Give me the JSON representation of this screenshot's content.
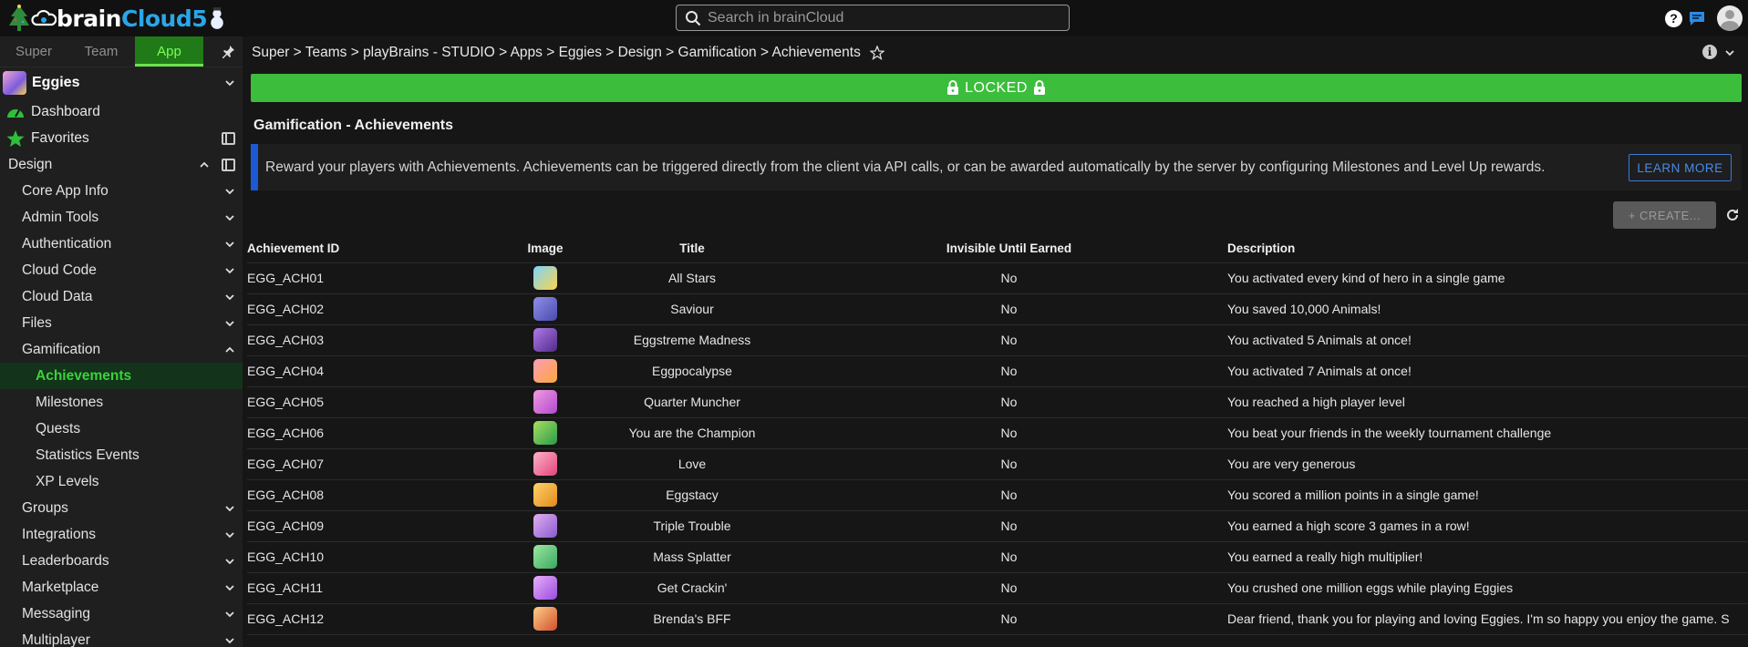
{
  "header": {
    "logo_part1": "brain",
    "logo_part2": "Cloud5",
    "search_placeholder": "Search in brainCloud",
    "help_label": "?"
  },
  "sidebar": {
    "tabs": [
      {
        "label": "Super",
        "active": false
      },
      {
        "label": "Team",
        "active": false
      },
      {
        "label": "App",
        "active": true
      }
    ],
    "app_name": "Eggies",
    "dashboard": "Dashboard",
    "favorites": "Favorites",
    "design": "Design",
    "items": [
      {
        "label": "Core App Info"
      },
      {
        "label": "Admin Tools"
      },
      {
        "label": "Authentication"
      },
      {
        "label": "Cloud Code"
      },
      {
        "label": "Cloud Data"
      },
      {
        "label": "Files"
      },
      {
        "label": "Gamification"
      }
    ],
    "gamification_sub": [
      {
        "label": "Achievements",
        "active": true
      },
      {
        "label": "Milestones"
      },
      {
        "label": "Quests"
      },
      {
        "label": "Statistics Events"
      },
      {
        "label": "XP Levels"
      }
    ],
    "items_after": [
      {
        "label": "Groups"
      },
      {
        "label": "Integrations"
      },
      {
        "label": "Leaderboards"
      },
      {
        "label": "Marketplace"
      },
      {
        "label": "Messaging"
      },
      {
        "label": "Multiplayer"
      }
    ]
  },
  "main": {
    "breadcrumb": "Super > Teams > playBrains - STUDIO > Apps > Eggies > Design > Gamification > Achievements",
    "info_label": "i",
    "locked_label": "LOCKED",
    "section_title": "Gamification - Achievements",
    "banner_text": "Reward your players with Achievements. Achievements can be triggered directly from the client via API calls, or can be awarded automatically by the server by configuring Milestones and Level Up rewards.",
    "learn_more": "LEARN MORE",
    "create_label": "+ CREATE...",
    "columns": {
      "id": "Achievement ID",
      "image": "Image",
      "title": "Title",
      "invisible": "Invisible Until Earned",
      "description": "Description"
    },
    "rows": [
      {
        "id": "EGG_ACH01",
        "title": "All Stars",
        "invisible": "No",
        "description": "You activated every kind of hero in a single game",
        "img": "linear-gradient(135deg,#7fd3ff,#f9d44a)"
      },
      {
        "id": "EGG_ACH02",
        "title": "Saviour",
        "invisible": "No",
        "description": "You saved 10,000 Animals!",
        "img": "linear-gradient(135deg,#8f8fe8,#4a4ab0)"
      },
      {
        "id": "EGG_ACH03",
        "title": "Eggstreme Madness",
        "invisible": "No",
        "description": "You activated 5 Animals at once!",
        "img": "linear-gradient(135deg,#b07ae8,#502a8a)"
      },
      {
        "id": "EGG_ACH04",
        "title": "Eggpocalypse",
        "invisible": "No",
        "description": "You activated 7 Animals at once!",
        "img": "linear-gradient(135deg,#ff9bb8,#f9a83a)"
      },
      {
        "id": "EGG_ACH05",
        "title": "Quarter Muncher",
        "invisible": "No",
        "description": "You reached a high player level",
        "img": "linear-gradient(135deg,#f29be0,#b04ad0)"
      },
      {
        "id": "EGG_ACH06",
        "title": "You are the Champion",
        "invisible": "No",
        "description": "You beat your friends in the weekly tournament challenge",
        "img": "linear-gradient(135deg,#a8e060,#2a9a4a)"
      },
      {
        "id": "EGG_ACH07",
        "title": "Love",
        "invisible": "No",
        "description": "You are very generous",
        "img": "linear-gradient(135deg,#ffb3c8,#e0457a)"
      },
      {
        "id": "EGG_ACH08",
        "title": "Eggstacy",
        "invisible": "No",
        "description": "You scored a million points in a single game!",
        "img": "linear-gradient(135deg,#ffd36a,#e08a1a)"
      },
      {
        "id": "EGG_ACH09",
        "title": "Triple Trouble",
        "invisible": "No",
        "description": "You earned a high score 3 games in a row!",
        "img": "linear-gradient(135deg,#e0b0f0,#8a5ad0)"
      },
      {
        "id": "EGG_ACH10",
        "title": "Mass Splatter",
        "invisible": "No",
        "description": "You earned a really high multiplier!",
        "img": "linear-gradient(135deg,#9de8a0,#3aa860)"
      },
      {
        "id": "EGG_ACH11",
        "title": "Get Crackin'",
        "invisible": "No",
        "description": "You crushed one million eggs while playing Eggies",
        "img": "linear-gradient(135deg,#e8b0f8,#9a4ae0)"
      },
      {
        "id": "EGG_ACH12",
        "title": "Brenda's BFF",
        "invisible": "No",
        "description": "Dear friend, thank you for playing and loving Eggies. I'm so happy you enjoy the game. S",
        "img": "linear-gradient(135deg,#ffcf8a,#d0502a)"
      }
    ]
  },
  "colors": {
    "accent_green": "#3cbd3c",
    "active_nav": "#3ad33a",
    "banner_accent": "#1d59d6",
    "brand_blue": "#2aa6e8"
  }
}
